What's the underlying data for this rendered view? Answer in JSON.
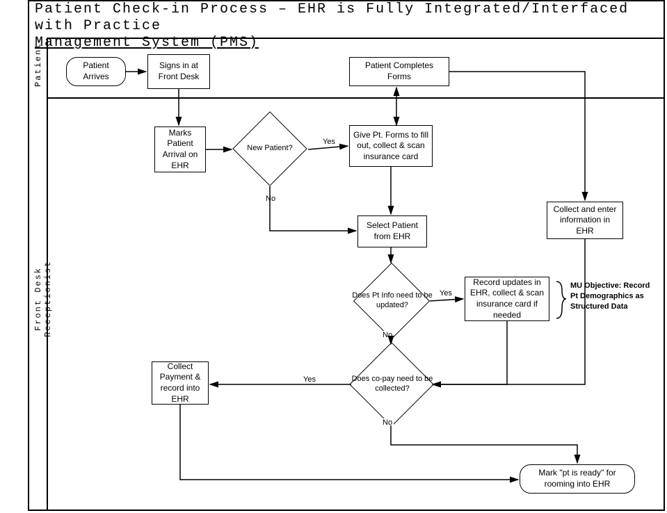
{
  "title_line1": "Patient Check-in Process – EHR is Fully Integrated/Interfaced with Practice",
  "title_line2": "Management System (PMS)",
  "lanes": {
    "patient": "Patient",
    "fdr": "Front Desk Receptionist"
  },
  "nodes": {
    "arrives": "Patient Arrives",
    "signs_in": "Signs in at Front Desk",
    "completes_forms": "Patient Completes Forms",
    "marks_arrival": "Marks Patient Arrival on EHR",
    "new_patient": "New Patient?",
    "give_forms": "Give Pt. Forms to fill out, collect & scan insurance card",
    "select_patient": "Select Patient from EHR",
    "collect_enter": "Collect  and enter information  in EHR",
    "need_update": "Does  Pt Info need to be updated?",
    "record_updates": "Record  updates in EHR, collect  & scan insurance card if needed",
    "mu_objective": "MU Objective: Record Pt Demographics as Structured Data",
    "copay": "Does  co-pay need to be collected?",
    "collect_payment": "Collect Payment & record into EHR",
    "mark_ready": "Mark  \"pt is ready\" for rooming  into EHR"
  },
  "labels": {
    "yes": "Yes",
    "no": "No"
  }
}
